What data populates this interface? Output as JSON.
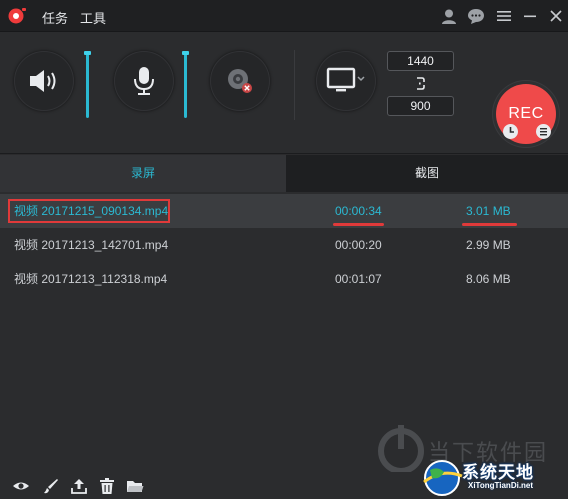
{
  "menu": {
    "task": "任务",
    "tools": "工具"
  },
  "dimensions": {
    "width": "1440",
    "height": "900"
  },
  "rec_label": "REC",
  "tabs": {
    "record": "录屏",
    "screenshot": "截图"
  },
  "files": [
    {
      "name": "视频 20171215_090134.mp4",
      "duration": "00:00:34",
      "size": "3.01 MB",
      "selected": true
    },
    {
      "name": "视频 20171213_142701.mp4",
      "duration": "00:00:20",
      "size": "2.99 MB",
      "selected": false
    },
    {
      "name": "视频 20171213_112318.mp4",
      "duration": "00:01:07",
      "size": "8.06 MB",
      "selected": false
    }
  ],
  "levels": {
    "speaker_volume": 0.97,
    "mic_volume": 0.97
  },
  "watermarks": {
    "primary": "当下软件园",
    "secondary": "系统天地",
    "secondary_url": "XiTongTianDi.net"
  },
  "colors": {
    "accent": "#2bb9d2",
    "record": "#ef4a4a",
    "highlight": "#e03a3a",
    "background": "#2b2c2e"
  }
}
